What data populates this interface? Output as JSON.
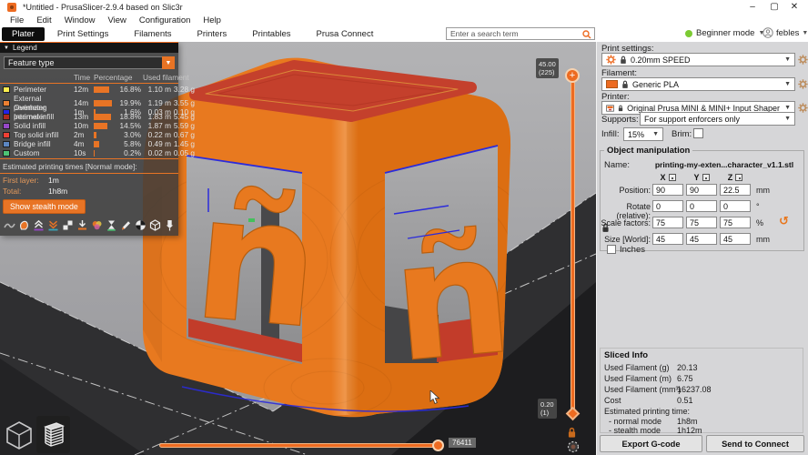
{
  "window": {
    "title": "*Untitled - PrusaSlicer-2.9.4 based on Slic3r"
  },
  "menu": {
    "items": [
      "File",
      "Edit",
      "Window",
      "View",
      "Configuration",
      "Help"
    ]
  },
  "tabs": {
    "items": [
      "Plater",
      "Print Settings",
      "Filaments",
      "Printers",
      "Printables",
      "Prusa Connect"
    ],
    "active": "Plater"
  },
  "topbar": {
    "search_placeholder": "Enter a search term",
    "mode_label": "Beginner mode",
    "user": "febles"
  },
  "legend": {
    "title": "Legend",
    "view_type": "Feature type",
    "columns": {
      "time": "Time",
      "percentage": "Percentage",
      "used_filament": "Used filament"
    },
    "rows": [
      {
        "label": "Perimeter",
        "color": "#FFEE4F",
        "time": "12m",
        "pct": 16.8,
        "pct_label": "16.8%",
        "m": "1.10 m",
        "g": "3.28 g"
      },
      {
        "label": "External perimeter",
        "color": "#ED8032",
        "time": "14m",
        "pct": 19.9,
        "pct_label": "19.9%",
        "m": "1.19 m",
        "g": "3.55 g"
      },
      {
        "label": "Overhang perimeter",
        "color": "#2222E8",
        "time": "1m",
        "pct": 1.6,
        "pct_label": "1.6%",
        "m": "0.03 m",
        "g": "0.10 g"
      },
      {
        "label": "Internal infill",
        "color": "#AE2A20",
        "time": "13m",
        "pct": 18.8,
        "pct_label": "18.8%",
        "m": "1.83 m",
        "g": "5.45 g"
      },
      {
        "label": "Solid infill",
        "color": "#9648C8",
        "time": "10m",
        "pct": 14.5,
        "pct_label": "14.5%",
        "m": "1.87 m",
        "g": "5.59 g"
      },
      {
        "label": "Top solid infill",
        "color": "#EE4034",
        "time": "2m",
        "pct": 3.0,
        "pct_label": "3.0%",
        "m": "0.22 m",
        "g": "0.67 g"
      },
      {
        "label": "Bridge infill",
        "color": "#5C87C2",
        "time": "4m",
        "pct": 5.8,
        "pct_label": "5.8%",
        "m": "0.49 m",
        "g": "1.45 g"
      },
      {
        "label": "Custom",
        "color": "#4DC475",
        "time": "10s",
        "pct": 0.2,
        "pct_label": "0.2%",
        "m": "0.02 m",
        "g": "0.05 g"
      }
    ],
    "estimated_title": "Estimated printing times [Normal mode]:",
    "first_layer_label": "First layer:",
    "first_layer_value": "1m",
    "total_label": "Total:",
    "total_value": "1h8m",
    "stealth_button": "Show stealth mode"
  },
  "viewport": {
    "toolbar_icons": [
      "travel-moves-icon",
      "wipe-moves-icon",
      "retractions-icon",
      "deretractions-icon",
      "seams-icon",
      "tool-changes-icon",
      "color-changes-icon",
      "pause-prints-icon",
      "custom-gcodes-icon",
      "center-of-mass-icon",
      "sliced-box-icon",
      "pin-legend-icon"
    ],
    "layer_slider": {
      "top_value": "45.00",
      "top_layer": "(225)",
      "bottom_value": "0.20",
      "bottom_layer": "(1)"
    },
    "move_slider": {
      "value": "76411"
    }
  },
  "panel": {
    "print_settings_label": "Print settings:",
    "print_settings_value": "0.20mm SPEED",
    "filament_label": "Filament:",
    "filament_value": "Generic PLA",
    "printer_label": "Printer:",
    "printer_value": "Original Prusa MINI & MINI+ Input Shaper",
    "supports_label": "Supports:",
    "supports_value": "For support enforcers only",
    "infill_label": "Infill:",
    "infill_value": "15%",
    "brim_label": "Brim:",
    "object_manipulation": {
      "title": "Object manipulation",
      "name_label": "Name:",
      "name_value": "printing-my-exten...character_v1.1.stl",
      "axes": [
        "X",
        "Y",
        "Z"
      ],
      "rows": [
        {
          "label": "Position:",
          "x": "90",
          "y": "90",
          "z": "22.5",
          "unit": "mm"
        },
        {
          "label": "Rotate (relative):",
          "x": "0",
          "y": "0",
          "z": "0",
          "unit": "°"
        },
        {
          "label": "Scale factors:",
          "x": "75",
          "y": "75",
          "z": "75",
          "unit": "%"
        },
        {
          "label": "Size [World]:",
          "x": "45",
          "y": "45",
          "z": "45",
          "unit": "mm"
        }
      ],
      "inches_label": "Inches"
    },
    "sliced_info": {
      "title": "Sliced Info",
      "rows": [
        {
          "label": "Used Filament (g)",
          "value": "20.13"
        },
        {
          "label": "Used Filament (m)",
          "value": "6.75"
        },
        {
          "label": "Used Filament (mm³)",
          "value": "16237.08"
        },
        {
          "label": "Cost",
          "value": "0.51"
        }
      ],
      "time_title": "Estimated printing time:",
      "time_rows": [
        {
          "label": "- normal mode",
          "value": "1h8m"
        },
        {
          "label": "- stealth mode",
          "value": "1h12m"
        }
      ]
    },
    "buttons": {
      "export": "Export G-code",
      "send": "Send to Connect"
    }
  },
  "colors": {
    "accent": "#ED6B21",
    "model_orange": "#E8791F",
    "top_infill_red": "#C4402C",
    "overhang_blue": "#2B2BDB"
  }
}
